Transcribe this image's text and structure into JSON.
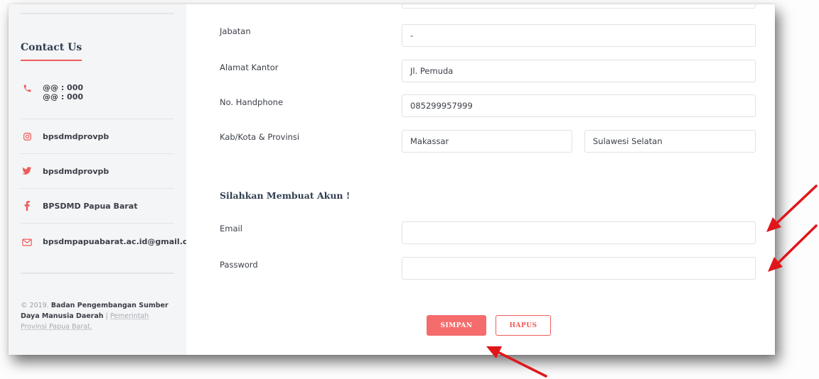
{
  "sidebar": {
    "contact_title": "Contact Us",
    "phone_lines": [
      "@@ : 000",
      "@@ : 000"
    ],
    "instagram": "bpsdmdprovpb",
    "twitter": "bpsdmdprovpb",
    "facebook": "BPSDMD Papua Barat",
    "email": "bpsdmpapuabarat.ac.id@gmail.com",
    "copyright": {
      "prefix": "© 2019.",
      "org": "Badan Pengembangan Sumber Daya Manusia Daerah",
      "separator": "|",
      "link": "Pemerintah Provinsi Papua Barat."
    }
  },
  "form": {
    "jabatan_label": "Jabatan",
    "jabatan_value": "-",
    "alamat_label": "Alamat Kantor",
    "alamat_value": "Jl. Pemuda",
    "hp_label": "No. Handphone",
    "hp_value": "085299957999",
    "kota_label": "Kab/Kota & Provinsi",
    "kota_value": "Makassar",
    "provinsi_value": "Sulawesi Selatan",
    "akun_title": "Silahkan Membuat Akun !",
    "email_label": "Email",
    "email_value": "",
    "password_label": "Password",
    "password_value": ""
  },
  "buttons": {
    "simpan": "SIMPAN",
    "hapus": "HAPUS"
  },
  "colors": {
    "accent": "#f05a5a",
    "button_fill": "#f46c6c",
    "arrow": "#e0161b",
    "sidebar_bg": "#f4f5f6",
    "heading": "#2f3d4f"
  },
  "icons": {
    "phone": "phone-icon",
    "instagram": "instagram-icon",
    "twitter": "twitter-icon",
    "facebook": "facebook-icon",
    "email": "mail-icon"
  }
}
